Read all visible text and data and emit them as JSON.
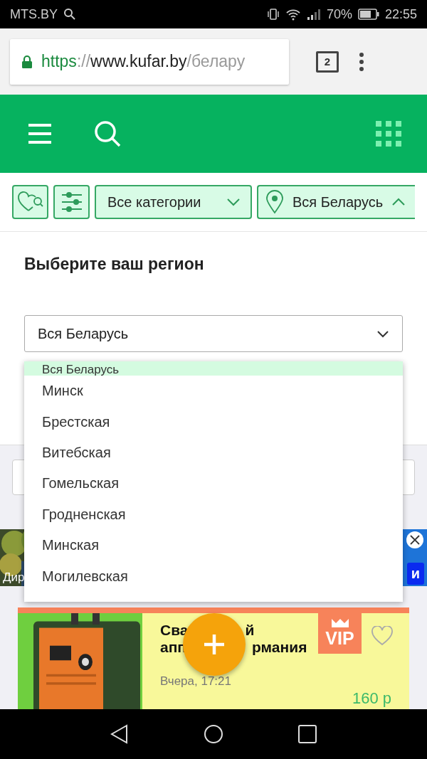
{
  "status_bar": {
    "carrier": "MTS.BY",
    "battery": "70%",
    "time": "22:55"
  },
  "browser": {
    "scheme": "https",
    "separator": "://",
    "host": "www.kufar.by",
    "path": "/белару",
    "tab_count": "2"
  },
  "filters": {
    "category": {
      "label": "Все категории",
      "expanded": false
    },
    "location": {
      "label": "Вся Беларусь",
      "expanded": true
    }
  },
  "region": {
    "title": "Выберите ваш регион",
    "value": "Вся Беларусь",
    "options": [
      {
        "label": "Вся Беларусь",
        "selected": true
      },
      {
        "label": "Минск",
        "selected": false
      },
      {
        "label": "Брестская",
        "selected": false
      },
      {
        "label": "Витебская",
        "selected": false
      },
      {
        "label": "Гомельская",
        "selected": false
      },
      {
        "label": "Гродненская",
        "selected": false
      },
      {
        "label": "Минская",
        "selected": false
      },
      {
        "label": "Могилевская",
        "selected": false
      }
    ]
  },
  "ad": {
    "caption": "Дир",
    "button": "и"
  },
  "listing": {
    "title_lines": [
      [
        "Сва",
        "й"
      ],
      [
        "апп",
        "рмания"
      ]
    ],
    "badge": "VIP",
    "time": "Вчера, 17:21",
    "price": "160 р"
  }
}
